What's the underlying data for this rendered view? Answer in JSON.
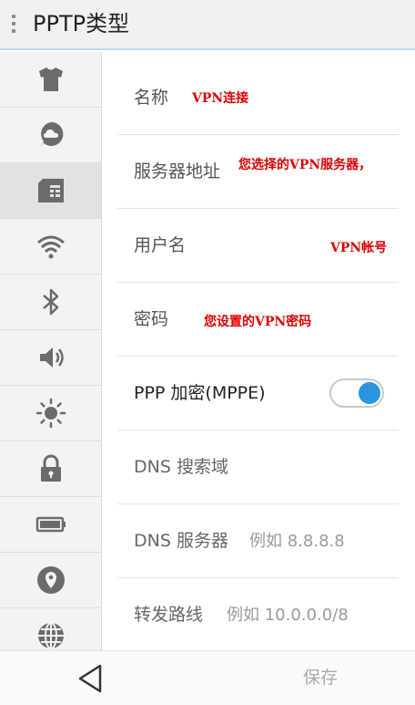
{
  "header": {
    "title": "PPTP类型"
  },
  "sidebar": {
    "items": [
      {
        "icon": "shirt-icon"
      },
      {
        "icon": "cloud-bubble-icon"
      },
      {
        "icon": "sim-card-icon",
        "active": true
      },
      {
        "icon": "wifi-icon"
      },
      {
        "icon": "bluetooth-icon"
      },
      {
        "icon": "volume-icon"
      },
      {
        "icon": "brightness-icon"
      },
      {
        "icon": "lock-icon"
      },
      {
        "icon": "battery-icon"
      },
      {
        "icon": "location-icon"
      },
      {
        "icon": "globe-icon"
      }
    ]
  },
  "form": {
    "name": {
      "label": "名称",
      "note": "VPN连接"
    },
    "server": {
      "label": "服务器地址",
      "note": "您选择的VPN服务器，"
    },
    "username": {
      "label": "用户名",
      "note": "VPN帐号"
    },
    "password": {
      "label": "密码",
      "note": "您设置的VPN密码"
    },
    "encryption": {
      "label": "PPP 加密(MPPE)",
      "enabled": true
    },
    "dns_search": {
      "label": "DNS 搜索域"
    },
    "dns_server": {
      "label": "DNS 服务器",
      "placeholder": "例如 8.8.8.8"
    },
    "routes": {
      "label": "转发路线",
      "placeholder": "例如 10.0.0.0/8"
    }
  },
  "footer": {
    "save_label": "保存"
  },
  "colors": {
    "accent": "#2a94df",
    "annotation": "#e00000"
  }
}
